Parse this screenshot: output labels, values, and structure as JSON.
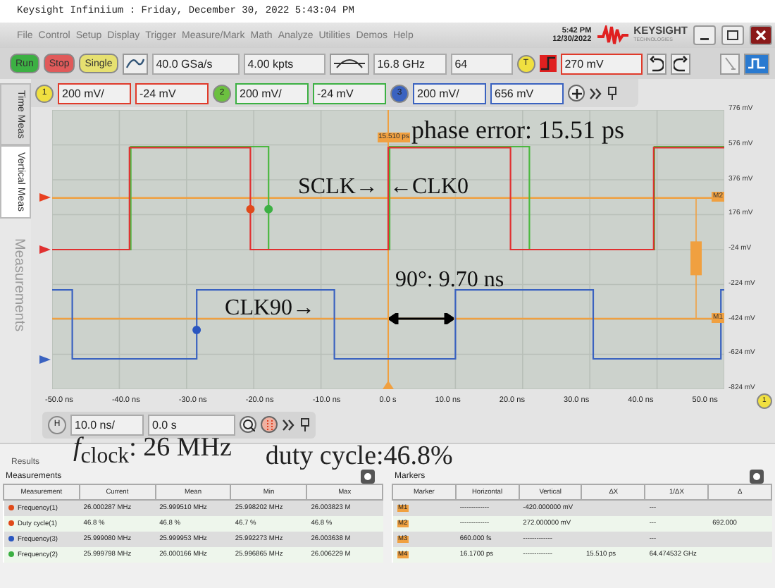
{
  "title_bar": "Keysight Infiniium : Friday, December 30, 2022 5:43:04 PM",
  "menu": [
    "File",
    "Control",
    "Setup",
    "Display",
    "Trigger",
    "Measure/Mark",
    "Math",
    "Analyze",
    "Utilities",
    "Demos",
    "Help"
  ],
  "clock": {
    "time": "5:42 PM",
    "date": "12/30/2022"
  },
  "logo": {
    "name": "KEYSIGHT",
    "sub": "TECHNOLOGIES"
  },
  "run_buttons": [
    {
      "label": "Run",
      "color": "#3cb043"
    },
    {
      "label": "Stop",
      "color": "#e05a5a"
    },
    {
      "label": "Single",
      "color": "#e6e070"
    }
  ],
  "acquisition": {
    "sample_rate": "40.0 GSa/s",
    "memory_depth": "4.00 kpts",
    "bandwidth": "16.8 GHz",
    "averages": "64"
  },
  "trigger": {
    "badge": "T",
    "level": "270 mV"
  },
  "channels": [
    {
      "badge": {
        "number": "1",
        "color": "#f0e040"
      },
      "color": "#e03a2a",
      "scale": "200 mV/",
      "offset": "-24 mV"
    },
    {
      "badge": {
        "number": "2",
        "color": "#6cc040"
      },
      "color": "#3cb043",
      "scale": "200 mV/",
      "offset": "-24 mV"
    },
    {
      "badge": {
        "number": "3",
        "color": "#3a62c0"
      },
      "color": "#3a62c0",
      "scale": "200 mV/",
      "offset": "656 mV"
    }
  ],
  "side_tabs": [
    {
      "label": "Time Meas",
      "selected": false,
      "disabled": false
    },
    {
      "label": "Vertical Meas",
      "selected": true,
      "disabled": false
    },
    {
      "label": "Measurements",
      "selected": false,
      "disabled": true
    }
  ],
  "scope": {
    "y_labels": [
      "776 mV",
      "576 mV",
      "376 mV",
      "176 mV",
      "-24 mV",
      "-224 mV",
      "-424 mV",
      "-624 mV",
      "-824 mV"
    ],
    "x_labels": [
      "-50.0 ns",
      "-40.0 ns",
      "-30.0 ns",
      "-20.0 ns",
      "-10.0 ns",
      "0.0 s",
      "10.0 ns",
      "20.0 ns",
      "30.0 ns",
      "40.0 ns",
      "50.0 ns"
    ],
    "phase_note": "phase error: 15.51 ps",
    "sclk_note": "SCLK→",
    "clk0_note": "←CLK0",
    "clk90_note": "CLK90→",
    "shift_note": "90°: 9.70 ns",
    "delta_tag": "15.510 ps",
    "marker_tags": [
      "M2",
      "M1"
    ],
    "source_badge": "1"
  },
  "horizontal": {
    "badge": "H",
    "scale": "10.0 ns/",
    "position": "0.0 s"
  },
  "results": {
    "label": "Results",
    "notes": [
      "*f*$_{clock}$: 26 MHz",
      "duty cycle:46.8%"
    ]
  },
  "measurements": {
    "title": "Measurements",
    "columns": [
      "Measurement",
      "Current",
      "Mean",
      "Min",
      "Max"
    ],
    "rows": [
      {
        "color": "#e04a1a",
        "cells": [
          "Frequency(1)",
          "26.000287 MHz",
          "25.999510 MHz",
          "25.998202 MHz",
          "26.003823 M"
        ]
      },
      {
        "color": "#e04a1a",
        "cells": [
          "Duty cycle(1)",
          "46.8 %",
          "46.8 %",
          "46.7 %",
          "46.8 %"
        ]
      },
      {
        "color": "#2a56c0",
        "cells": [
          "Frequency(3)",
          "25.999080 MHz",
          "25.999953 MHz",
          "25.992273 MHz",
          "26.003638 M"
        ]
      },
      {
        "color": "#3cb043",
        "cells": [
          "Frequency(2)",
          "25.999798 MHz",
          "26.000166 MHz",
          "25.996865 MHz",
          "26.006229 M"
        ]
      }
    ]
  },
  "markers": {
    "title": "Markers",
    "columns": [
      "Marker",
      "Horizontal",
      "Vertical",
      "ΔX",
      "1/ΔX",
      "Δ"
    ],
    "rows": [
      {
        "marker": "M1",
        "horizontal": "-------------",
        "vertical": "-420.000000 mV",
        "inverse_delta_x": "---"
      },
      {
        "marker": "M2",
        "horizontal": "-------------",
        "vertical": "272.000000 mV",
        "inverse_delta_x": "---",
        "column_6": "692.000"
      },
      {
        "marker": "M3",
        "horizontal": "660.000 fs",
        "vertical": "-------------",
        "inverse_delta_x": "---"
      },
      {
        "marker": "M4",
        "horizontal": "16.1700 ps",
        "vertical": "-------------",
        "delta_x": "15.510 ps",
        "inverse_delta_x": "64.474532 GHz"
      }
    ]
  }
}
